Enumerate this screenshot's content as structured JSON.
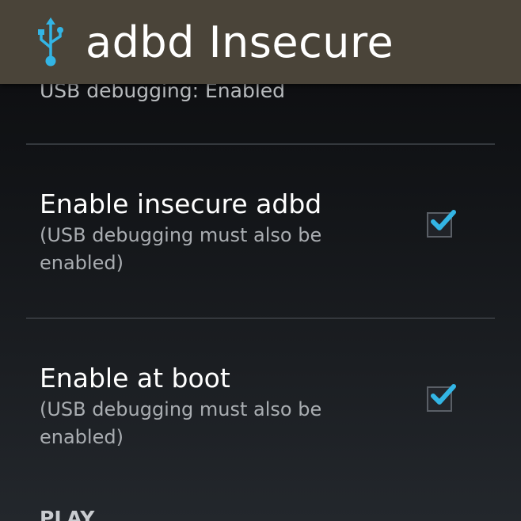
{
  "action_bar": {
    "title": "adbd Insecure",
    "icon": "usb-icon",
    "background": "#4a4439",
    "icon_color": "#33b5e5"
  },
  "status": {
    "usb_debugging": "USB debugging: Enabled"
  },
  "preferences": [
    {
      "title": "Enable insecure adbd",
      "summary": "(USB debugging must also be enabled)",
      "checked": true
    },
    {
      "title": "Enable at boot",
      "summary": "(USB debugging must also be enabled)",
      "checked": true
    }
  ],
  "section_header": "PLAY",
  "colors": {
    "accent": "#33b5e5",
    "divider": "#34383d"
  }
}
